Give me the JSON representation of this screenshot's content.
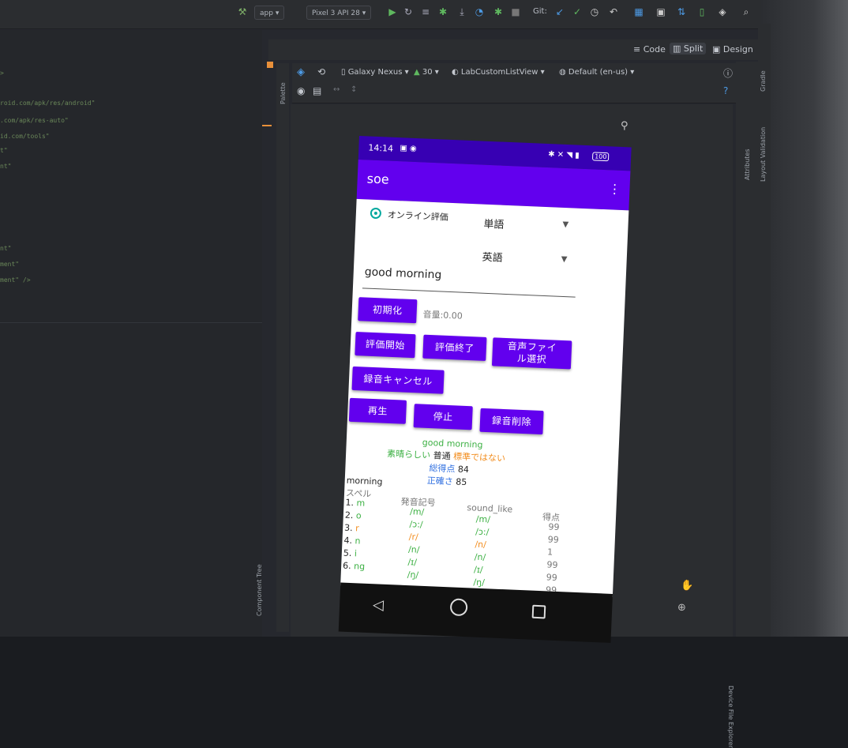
{
  "toolbar": {
    "run_config": "app",
    "device": "Pixel 3 API 28",
    "git_label": "Git:"
  },
  "view_modes": {
    "code": "Code",
    "split": "Split",
    "design": "Design"
  },
  "design_toolbar": {
    "device": "Galaxy Nexus",
    "api": "30",
    "activity": "LabCustomListView",
    "locale": "Default (en-us)"
  },
  "side_panels": {
    "palette": "Palette",
    "component_tree": "Component Tree",
    "attributes": "Attributes",
    "gradle": "Gradle",
    "layout_validation": "Layout Validation",
    "device_explorer": "Device File Explorer"
  },
  "phone": {
    "status_time": "14:14",
    "battery": "100",
    "app_title": "soe",
    "radio_label": "オンライン評価",
    "spinner1": "単語",
    "spinner2": "英語",
    "input_text": "good morning",
    "buttons": {
      "init": "初期化",
      "start": "評価開始",
      "end": "評価終了",
      "file": "音声ファイル選択",
      "file_line1": "音声ファイ",
      "file_line2": "ル選択",
      "cancel": "録音キャンセル",
      "play": "再生",
      "stop": "停止",
      "delete": "録音削除"
    },
    "volume": "音量:0.00",
    "result": {
      "word_good": "good",
      "word_morning": "morning",
      "legend_excellent": "素晴らしい",
      "legend_normal": "普通",
      "legend_bad": "標準ではない",
      "total_label": "総得点",
      "total_value": "84",
      "accuracy_label": "正確さ",
      "accuracy_value": "85"
    },
    "table": {
      "word": "morning",
      "headers": [
        "スペル",
        "発音記号",
        "sound_like",
        "得点"
      ],
      "rows": [
        {
          "spell": "1. m",
          "ipa": "/m/",
          "like": "/m/",
          "score": "99",
          "color": "green"
        },
        {
          "spell": "2. o",
          "ipa": "/ɔ:/",
          "like": "/ɔ:/",
          "score": "99",
          "color": "green"
        },
        {
          "spell": "3. r",
          "ipa": "/r/",
          "like": "/n/",
          "score": "1",
          "color": "orange"
        },
        {
          "spell": "4. n",
          "ipa": "/n/",
          "like": "/n/",
          "score": "99",
          "color": "green"
        },
        {
          "spell": "5. i",
          "ipa": "/ɪ/",
          "like": "/ɪ/",
          "score": "99",
          "color": "green"
        },
        {
          "spell": "6. ng",
          "ipa": "/ŋ/",
          "like": "/ŋ/",
          "score": "99",
          "color": "green"
        }
      ]
    }
  },
  "colors": {
    "primary": "#6200ee",
    "primary_dark": "#3700b3",
    "good": "#3cb043",
    "warn": "#f28c1c",
    "score_label": "#2f6fe0"
  }
}
